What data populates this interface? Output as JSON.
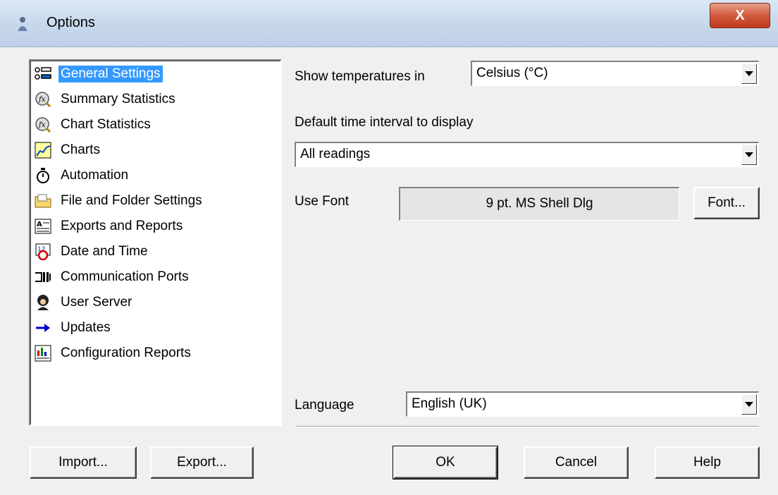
{
  "window": {
    "title": "Options",
    "close_label": "X"
  },
  "categories": [
    {
      "label": "General Settings",
      "icon": "settings-list-icon",
      "selected": true
    },
    {
      "label": "Summary Statistics",
      "icon": "function-magnifier-icon"
    },
    {
      "label": "Chart Statistics",
      "icon": "function-magnifier-icon"
    },
    {
      "label": "Charts",
      "icon": "line-chart-icon"
    },
    {
      "label": "Automation",
      "icon": "stopwatch-icon"
    },
    {
      "label": "File and Folder Settings",
      "icon": "folder-icon"
    },
    {
      "label": "Exports and Reports",
      "icon": "report-icon"
    },
    {
      "label": "Date and Time",
      "icon": "calendar-clock-icon"
    },
    {
      "label": "Communication Ports",
      "icon": "port-icon"
    },
    {
      "label": "User Server",
      "icon": "user-icon"
    },
    {
      "label": "Updates",
      "icon": "arrow-right-icon"
    },
    {
      "label": "Configuration Reports",
      "icon": "config-report-icon"
    }
  ],
  "general": {
    "temp_label": "Show temperatures in",
    "temp_value": "Celsius (°C)",
    "interval_label": "Default time interval to display",
    "interval_value": "All readings",
    "font_label": "Use Font",
    "font_value": "9 pt. MS Shell Dlg",
    "font_button": "Font...",
    "language_label": "Language",
    "language_value": "English (UK)"
  },
  "buttons": {
    "import": "Import...",
    "export": "Export...",
    "ok": "OK",
    "cancel": "Cancel",
    "help": "Help"
  }
}
